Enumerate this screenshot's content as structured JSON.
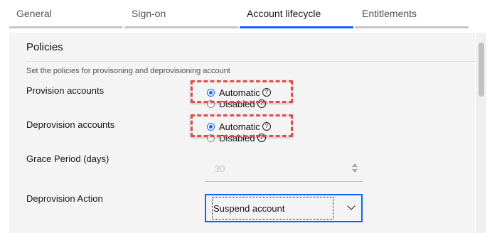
{
  "tabs": [
    {
      "label": "General"
    },
    {
      "label": "Sign-on"
    },
    {
      "label": "Account lifecycle"
    },
    {
      "label": "Entitlements"
    }
  ],
  "section": {
    "title": "Policies",
    "description": "Set the policies for provisoning and deprovisioning account"
  },
  "provision": {
    "label": "Provision accounts",
    "options": [
      "Automatic",
      "Disabled"
    ],
    "selected": "Automatic"
  },
  "deprovision": {
    "label": "Deprovision accounts",
    "options": [
      "Automatic",
      "Disabled"
    ],
    "selected": "Automatic"
  },
  "grace_period": {
    "label": "Grace Period (days)",
    "value": "30"
  },
  "deprovision_action": {
    "label": "Deprovision Action",
    "value": "Suspend account"
  },
  "icons": {
    "help": "?"
  },
  "colors": {
    "accent": "#0f62fe",
    "highlight": "#da4f4a",
    "panel": "#f4f4f4"
  }
}
